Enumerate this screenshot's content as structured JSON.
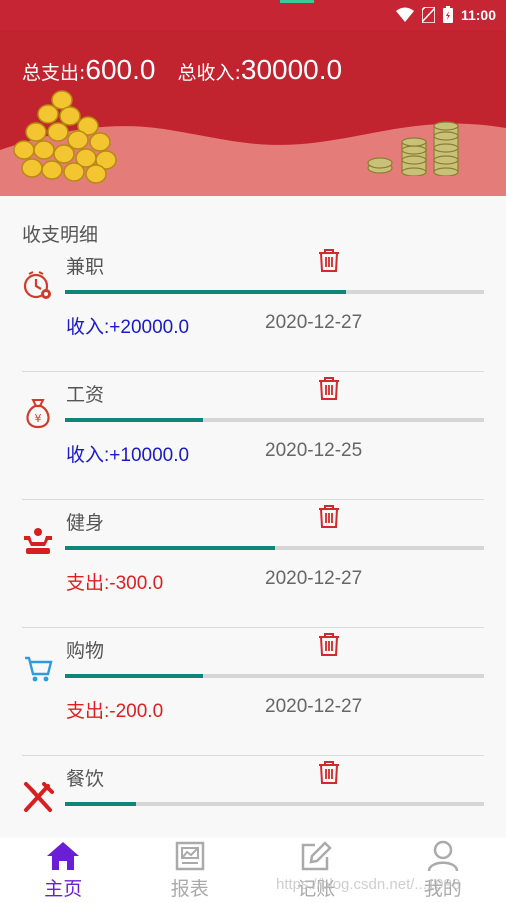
{
  "status_bar": {
    "time": "11:00"
  },
  "header": {
    "total_expense_label": "总支出:",
    "total_expense_value": "600.0",
    "total_income_label": "总收入:",
    "total_income_value": "30000.0"
  },
  "section_title": "收支明细",
  "records": [
    {
      "name": "兼职",
      "icon": "clock-coin-icon",
      "type": "income",
      "amount": "收入:+20000.0",
      "date": "2020-12-27",
      "progress": 0.67
    },
    {
      "name": "工资",
      "icon": "money-bag-icon",
      "type": "income",
      "amount": "收入:+10000.0",
      "date": "2020-12-25",
      "progress": 0.33
    },
    {
      "name": "健身",
      "icon": "fitness-icon",
      "type": "expense",
      "amount": "支出:-300.0",
      "date": "2020-12-27",
      "progress": 0.5
    },
    {
      "name": "购物",
      "icon": "shopping-cart-icon",
      "type": "expense",
      "amount": "支出:-200.0",
      "date": "2020-12-27",
      "progress": 0.33
    },
    {
      "name": "餐饮",
      "icon": "fork-knife-icon",
      "type": "expense",
      "amount": "",
      "date": "",
      "progress": 0.17
    }
  ],
  "bottom_nav": [
    {
      "label": "主页",
      "icon": "home-icon",
      "active": true
    },
    {
      "label": "报表",
      "icon": "chart-icon",
      "active": false
    },
    {
      "label": "记账",
      "icon": "edit-icon",
      "active": false
    },
    {
      "label": "我的",
      "icon": "user-icon",
      "active": false
    }
  ],
  "watermark": "https://blog.csdn.net/...1998",
  "colors": {
    "header_bg": "#c1232f",
    "income_text": "#1a1acc",
    "expense_text": "#e01e1e",
    "progress_fill": "#0f8577",
    "nav_active": "#6a1ed8",
    "trash_icon": "#d12a2a"
  }
}
